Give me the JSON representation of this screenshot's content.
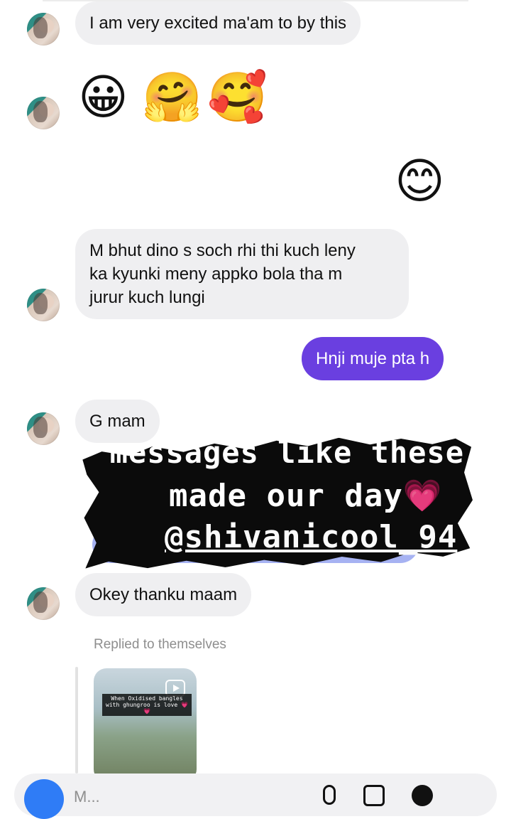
{
  "messages": [
    {
      "type": "incoming",
      "text": "I am very excited ma'am to by this"
    },
    {
      "type": "incoming-emoji",
      "emojis": [
        "😀",
        "🤗",
        "🥰"
      ]
    },
    {
      "type": "outgoing-emoji",
      "emojis": [
        "😊"
      ]
    },
    {
      "type": "incoming",
      "text": "M bhut dino s soch rhi thi kuch leny\nka kyunki meny appko bola tha m\njurur kuch lungi"
    },
    {
      "type": "outgoing",
      "text": "Hnji muje pta h"
    },
    {
      "type": "incoming",
      "text": "G mam"
    },
    {
      "type": "incoming",
      "text": "Okey thanku maam"
    }
  ],
  "overlay": {
    "line1": "messages like these",
    "line2": "made our day",
    "heart": "💗",
    "handle": "@shivanicool_94"
  },
  "reply": {
    "label": "Replied to themselves",
    "reel_caption": "When Oxidised bangles with ghungroo is love 💗💗"
  },
  "composer": {
    "placeholder": "M..."
  },
  "colors": {
    "incoming_bubble": "#efeff1",
    "outgoing_bubble": "#6a3fe0",
    "camera_button": "#2f7cf6"
  },
  "icons": [
    "camera-icon",
    "microphone-icon",
    "gallery-icon",
    "plus-icon",
    "reel-play-icon"
  ]
}
